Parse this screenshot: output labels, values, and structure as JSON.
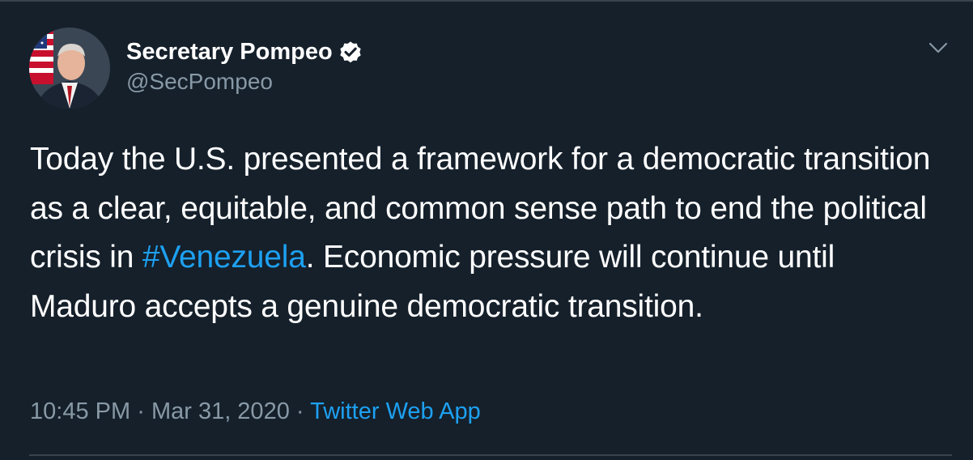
{
  "author": {
    "display_name": "Secretary Pompeo",
    "handle": "@SecPompeo",
    "verified": true
  },
  "tweet": {
    "text_before": "Today the U.S. presented a framework for a democratic transition as a clear, equitable, and common sense path to end the political crisis in ",
    "hashtag": "#Venezuela",
    "text_after": ". Economic pressure will continue until Maduro accepts a genuine democratic transition."
  },
  "meta": {
    "time": "10:45 PM",
    "separator": "·",
    "date": "Mar 31, 2020",
    "source": "Twitter Web App"
  },
  "icons": {
    "verified": "verified-badge-icon",
    "menu": "chevron-down-icon"
  },
  "colors": {
    "background": "#15202b",
    "text": "#ffffff",
    "secondary": "#8899a6",
    "accent": "#1da1f2",
    "border": "#38444d"
  }
}
